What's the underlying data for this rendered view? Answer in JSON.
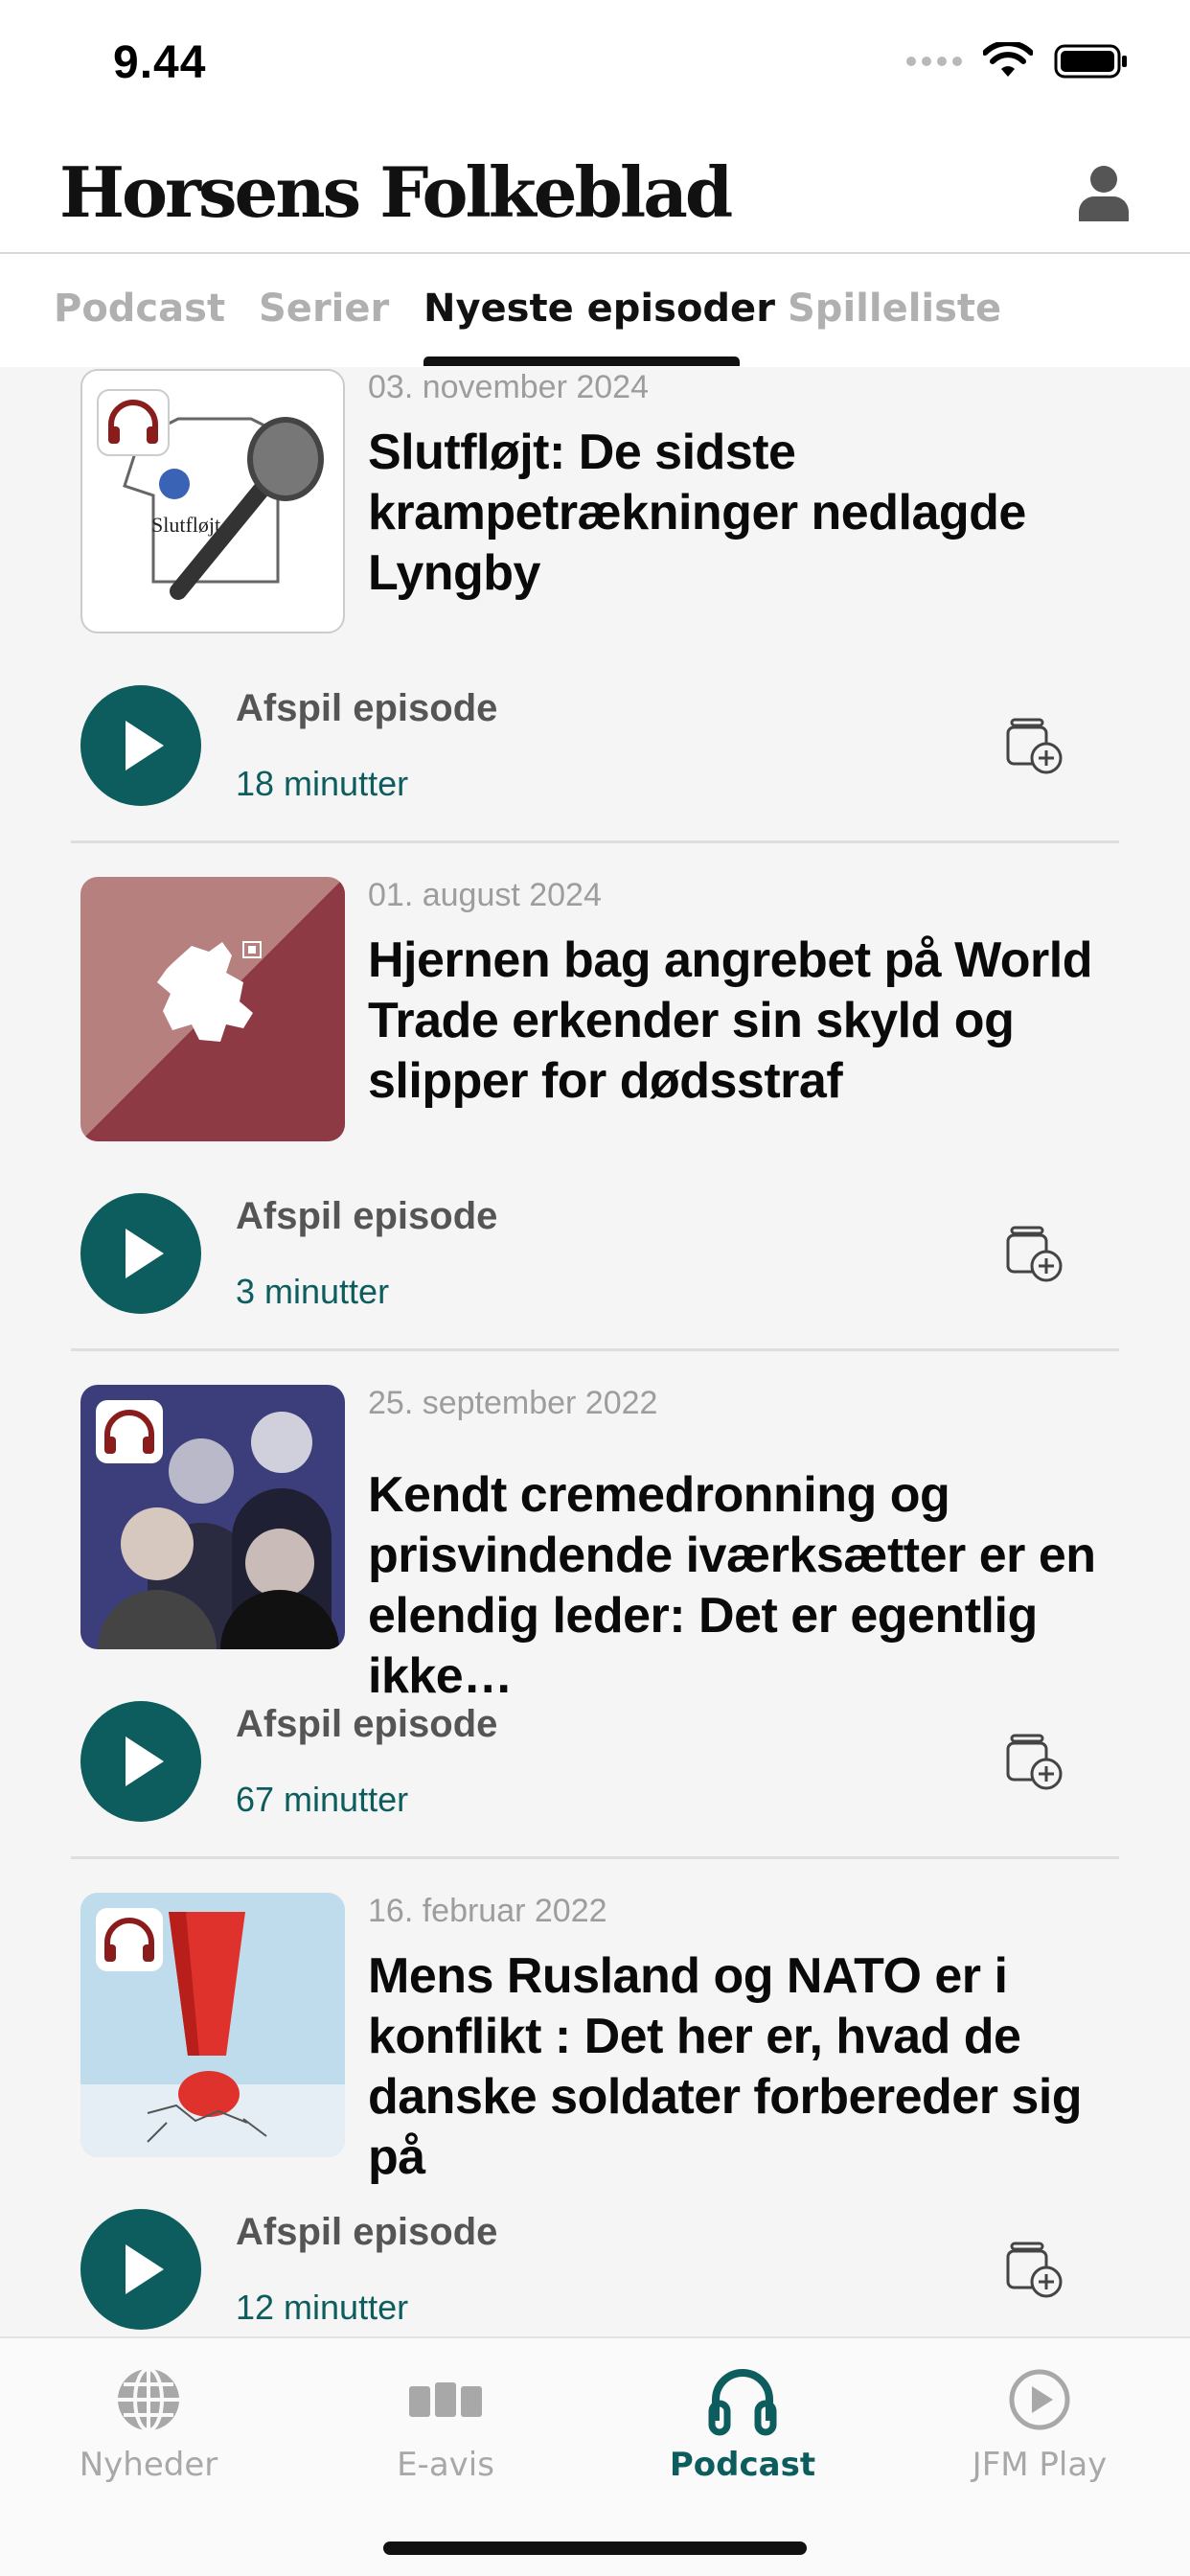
{
  "status_bar": {
    "time": "9.44"
  },
  "header": {
    "brand": "Horsens Folkeblad"
  },
  "tabs": [
    {
      "label": "Podcast"
    },
    {
      "label": "Serier"
    },
    {
      "label": "Nyeste episoder"
    },
    {
      "label": "Spilleliste"
    }
  ],
  "episodes": [
    {
      "date": "03. november 2024",
      "title": "Slutfløjt: De sidste krampetrækninger nedlagde Lyngby",
      "play_label": "Afspil episode",
      "duration": "18 minutter",
      "thumb_text": "Slutfløjt"
    },
    {
      "date": "01. august 2024",
      "title": "Hjernen bag angrebet på World Trade erkender sin skyld og slipper for dødsstraf",
      "play_label": "Afspil episode",
      "duration": "3 minutter"
    },
    {
      "date": "25. september 2022",
      "title": "Kendt cremedronning og prisvindende iværksætter er en elendig leder: Det er egentlig ikke…",
      "play_label": "Afspil episode",
      "duration": "67 minutter"
    },
    {
      "date": "16. februar 2022",
      "title": "Mens Rusland og NATO er i konflikt : Det her er, hvad de danske soldater forbereder sig på",
      "play_label": "Afspil episode",
      "duration": "12 minutter"
    }
  ],
  "bottom_nav": [
    {
      "label": "Nyheder",
      "icon": "globe-icon"
    },
    {
      "label": "E-avis",
      "icon": "newspaper-icon"
    },
    {
      "label": "Podcast",
      "icon": "headphones-icon",
      "active": true
    },
    {
      "label": "JFM Play",
      "icon": "play-circle-icon"
    }
  ],
  "colors": {
    "accent": "#0d5c5e",
    "inactive": "#a8a8a8",
    "list_bg": "#f5f5f5"
  }
}
